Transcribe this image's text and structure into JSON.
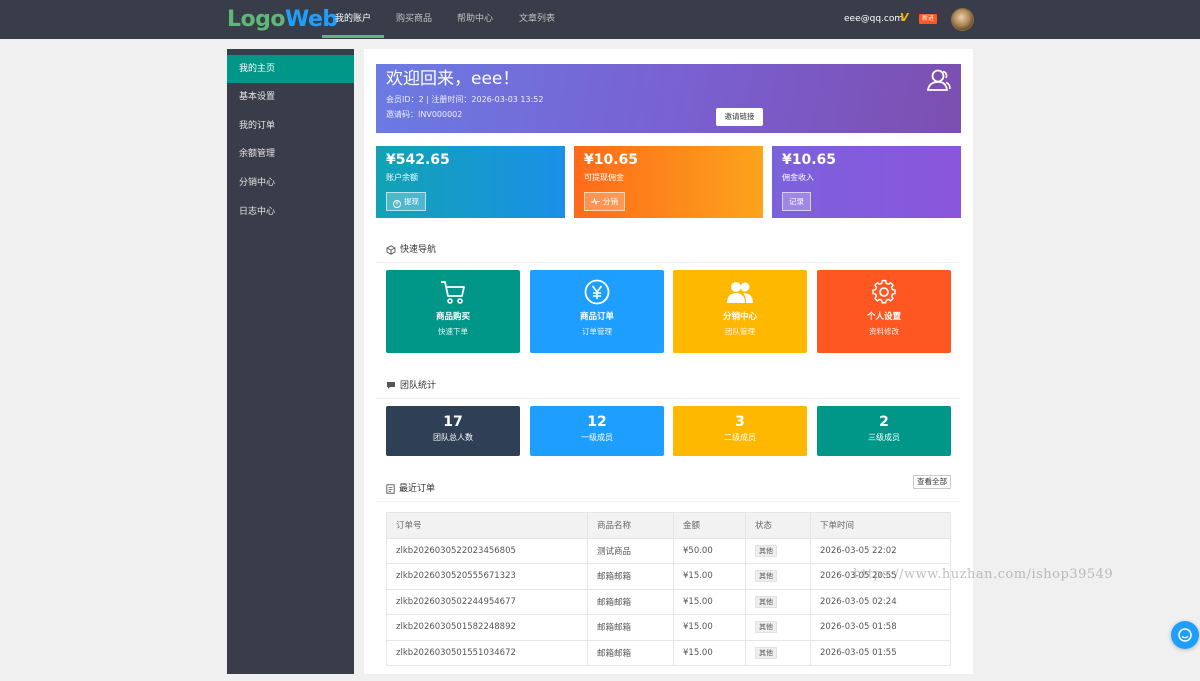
{
  "header": {
    "logo_part1": "Logo",
    "logo_part2": "Web",
    "nav": [
      {
        "label": "我的账户",
        "active": true
      },
      {
        "label": "购买商品",
        "active": false
      },
      {
        "label": "帮助中心",
        "active": false
      },
      {
        "label": "文章列表",
        "active": false
      }
    ],
    "user_email": "eee@qq.com",
    "vip_mark": "V",
    "new_badge": "新进",
    "avatar_icon": "avatar-photo"
  },
  "sidebar": {
    "items": [
      {
        "label": "我的主页",
        "active": true
      },
      {
        "label": "基本设置",
        "active": false
      },
      {
        "label": "我的订单",
        "active": false
      },
      {
        "label": "余额管理",
        "active": false
      },
      {
        "label": "分销中心",
        "active": false
      },
      {
        "label": "日志中心",
        "active": false
      }
    ]
  },
  "welcome": {
    "title": "欢迎回来，eee！",
    "member_line": "会员ID：2 | 注册时间：2026-03-03 13:52",
    "invite_code_line": "邀请码：INV000002",
    "invite_button": "邀请链接",
    "icon": "user-group-icon"
  },
  "stats": [
    {
      "amount": "¥542.65",
      "label": "账户余额",
      "button": "提现",
      "button_icon": "yen-circle-icon"
    },
    {
      "amount": "¥10.65",
      "label": "可提现佣金",
      "button": "分销",
      "button_icon": "pulse-icon"
    },
    {
      "amount": "¥10.65",
      "label": "佣金收入",
      "button": "记录",
      "button_icon": ""
    }
  ],
  "quick_nav": {
    "title": "快速导航",
    "items": [
      {
        "title": "商品购买",
        "subtitle": "快速下单",
        "icon": "cart-icon",
        "color": "#009688"
      },
      {
        "title": "商品订单",
        "subtitle": "订单管理",
        "icon": "yen-circle-icon",
        "color": "#1e9fff"
      },
      {
        "title": "分销中心",
        "subtitle": "团队管理",
        "icon": "users-icon",
        "color": "#ffb800"
      },
      {
        "title": "个人设置",
        "subtitle": "资料修改",
        "icon": "gear-icon",
        "color": "#ff5722"
      }
    ]
  },
  "team": {
    "title": "团队统计",
    "items": [
      {
        "value": "17",
        "label": "团队总人数",
        "color": "#2f4056"
      },
      {
        "value": "12",
        "label": "一级成员",
        "color": "#1e9fff"
      },
      {
        "value": "3",
        "label": "二级成员",
        "color": "#ffb800"
      },
      {
        "value": "2",
        "label": "三级成员",
        "color": "#009688"
      }
    ]
  },
  "orders": {
    "title": "最近订单",
    "view_all": "查看全部",
    "columns": [
      "订单号",
      "商品名称",
      "金额",
      "状态",
      "下单时间"
    ],
    "rows": [
      [
        "zlkb2026030522023456805",
        "测试商品",
        "¥50.00",
        "其他",
        "2026-03-05 22:02"
      ],
      [
        "zlkb2026030520555671323",
        "邮箱邮箱",
        "¥15.00",
        "其他",
        "2026-03-05 20:55"
      ],
      [
        "zlkb2026030502244954677",
        "邮箱邮箱",
        "¥15.00",
        "其他",
        "2026-03-05 02:24"
      ],
      [
        "zlkb2026030501582248892",
        "邮箱邮箱",
        "¥15.00",
        "其他",
        "2026-03-05 01:58"
      ],
      [
        "zlkb2026030501551034672",
        "邮箱邮箱",
        "¥15.00",
        "其他",
        "2026-03-05 01:55"
      ]
    ]
  },
  "watermark": "https://www.huzhan.com/ishop39549",
  "floating": {
    "chat_icon": "chat-bubble-icon"
  }
}
